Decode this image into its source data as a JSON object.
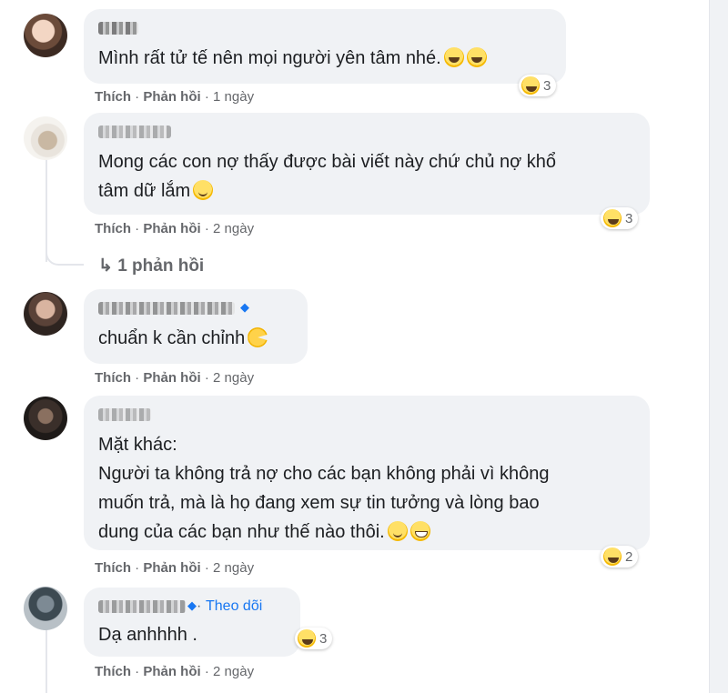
{
  "comments": [
    {
      "lines": [
        "Mình rất tử tế nên mọi người yên tâm nhé."
      ],
      "like_label": "Thích",
      "reply_label": "Phản hồi",
      "time": "1 ngày",
      "reaction_count": "3"
    },
    {
      "lines": [
        "Mong các con nợ thấy được bài viết này chứ chủ nợ khổ",
        "tâm dữ lắm"
      ],
      "like_label": "Thích",
      "reply_label": "Phản hồi",
      "time": "2 ngày",
      "reaction_count": "3",
      "replies_link": "1 phản hồi"
    },
    {
      "lines": [
        "chuẩn k cần chỉnh"
      ],
      "like_label": "Thích",
      "reply_label": "Phản hồi",
      "time": "2 ngày"
    },
    {
      "lines": [
        "Mặt khác:",
        "Người ta không trả nợ cho các bạn không phải vì không",
        "muốn trả, mà là họ đang xem sự tin tưởng và lòng bao",
        "dung của các bạn như thế nào thôi."
      ],
      "like_label": "Thích",
      "reply_label": "Phản hồi",
      "time": "2 ngày",
      "reaction_count": "2"
    },
    {
      "follow_label": "Theo dõi",
      "lines": [
        "Dạ anhhhh ."
      ],
      "like_label": "Thích",
      "reply_label": "Phản hồi",
      "time": "2 ngày",
      "reaction_count": "3"
    }
  ],
  "separator": "·",
  "reply_arrow": "↳",
  "colors": {
    "bubble": "#f0f2f5",
    "meta": "#65676b",
    "link": "#1877f2"
  },
  "icons": [
    "laugh-emoji-icon",
    "smile-emoji-icon",
    "pacman-emoji-icon",
    "grin-emoji-icon",
    "verified-badge-icon",
    "reply-arrow-icon"
  ]
}
